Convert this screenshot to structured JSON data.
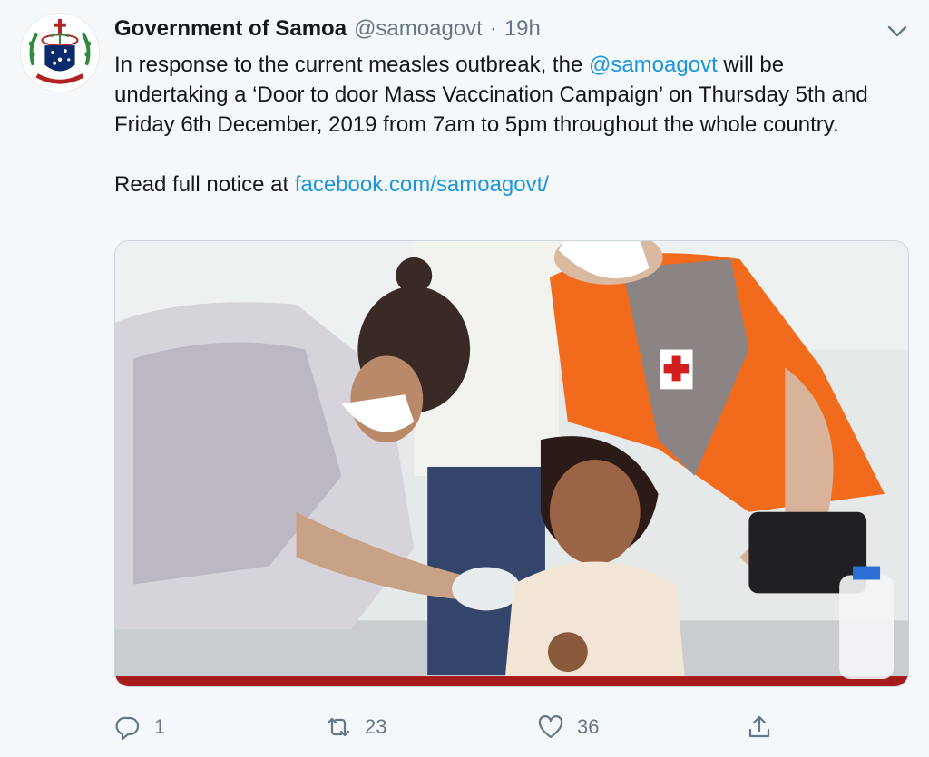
{
  "tweet": {
    "author_name": "Government of Samoa",
    "author_handle": "@samoagovt",
    "separator": "·",
    "timestamp": "19h",
    "text": {
      "line1_pre": "In response to the current measles outbreak, the ",
      "mention": "@samoagovt",
      "line1_post": " will be undertaking a ‘Door to door Mass Vaccination Campaign’ on Thursday 5th and Friday 6th December, 2019 from 7am to 5pm throughout the whole country.",
      "line2_pre": "Read full notice at ",
      "url": "facebook.com/samoagovt/"
    },
    "media_description": "Health worker vaccinating a child",
    "logo_motto": "FAAVAE I LE ATUA SAMOA"
  },
  "actions": {
    "reply_count": "1",
    "retweet_count": "23",
    "like_count": "36"
  },
  "icons": {
    "avatar": "samoa-coat-of-arms-icon",
    "caret": "chevron-down-icon",
    "reply": "reply-icon",
    "retweet": "retweet-icon",
    "like": "heart-icon",
    "share": "share-icon"
  },
  "colors": {
    "link": "#1b95e0",
    "muted": "#657786",
    "text": "#14171a",
    "background": "#f5f8fa"
  }
}
